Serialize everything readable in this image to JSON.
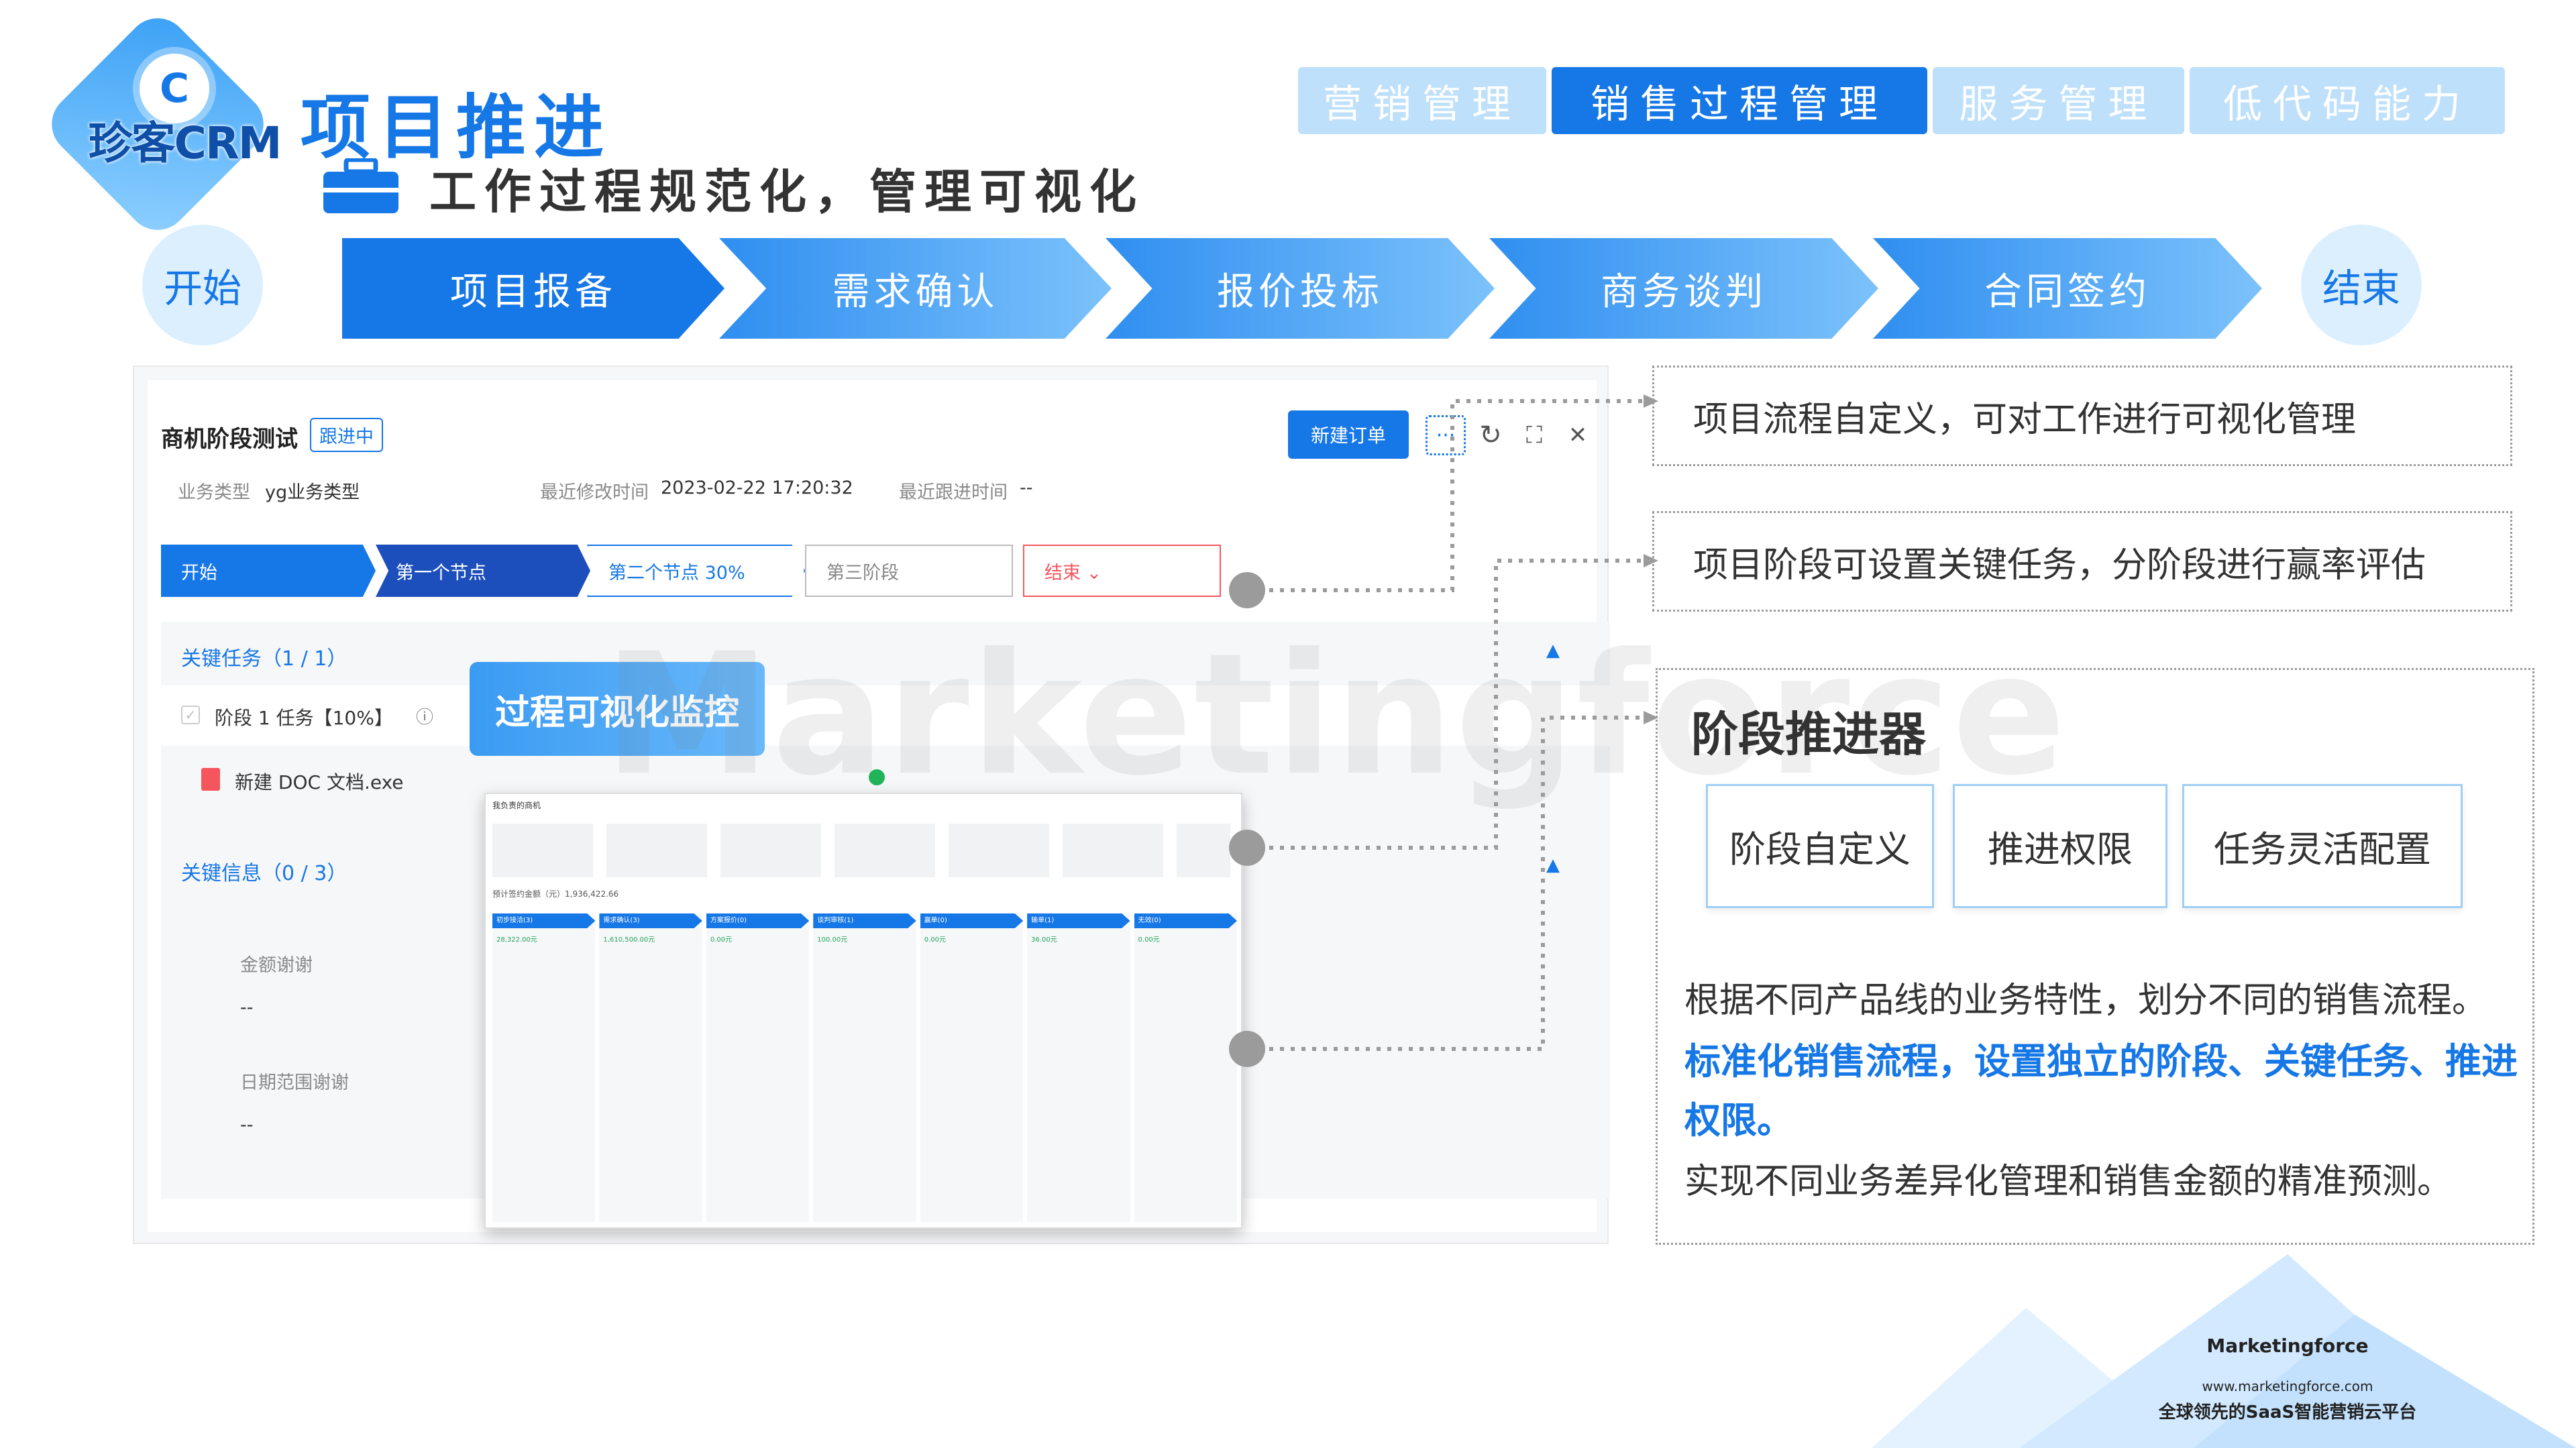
{
  "brand": {
    "logo_letter": "C",
    "logo_text": "珍客CRM"
  },
  "header": {
    "title": "项目推进",
    "subtitle": "工作过程规范化，管理可视化"
  },
  "nav": {
    "tabs": [
      {
        "label": "营销管理",
        "active": false
      },
      {
        "label": "销售过程管理",
        "active": true
      },
      {
        "label": "服务管理",
        "active": false
      },
      {
        "label": "低代码能力",
        "active": false
      }
    ]
  },
  "process": {
    "start": "开始",
    "end": "结束",
    "steps": [
      "项目报备",
      "需求确认",
      "报价投标",
      "商务谈判",
      "合同签约"
    ]
  },
  "app": {
    "title": "商机阶段测试",
    "badge": "跟进中",
    "business_type_label": "业务类型",
    "business_type_value": "yg业务类型",
    "modified_label": "最近修改时间",
    "modified_value": "2023-02-22 17:20:32",
    "followup_label": "最近跟进时间",
    "followup_value": "--",
    "new_order_label": "新建订单",
    "more_label": "···",
    "refresh_icon": "↻",
    "expand_icon": "⛶",
    "close_icon": "✕",
    "stages": [
      "开始",
      "第一个节点",
      "第二个节点 30%",
      "第三阶段",
      "结束 ⌄"
    ],
    "key_tasks_title": "关键任务（1 / 1）",
    "task_item": "阶段 1 任务【10%】",
    "task_file": "新建 DOC 文档.exe",
    "key_info_title": "关键信息（0 / 3）",
    "field1_label": "金额谢谢",
    "field1_value": "--",
    "field2_label": "日期范围谢谢",
    "field2_value": "--",
    "collapse_label": "收起",
    "monitor_label": "过程可视化监控",
    "mini_title": "我负责的商机",
    "mini_stats": "预计签约金额（元）1,936,422.66",
    "mini_columns": [
      "初步接洽(3)",
      "需求确认(3)",
      "方案报价(0)",
      "谈判审核(1)",
      "赢单(0)",
      "输单(1)",
      "无效(0)"
    ],
    "mini_amounts": [
      "28,322.00元",
      "1,610,500.00元",
      "0.00元",
      "100.00元",
      "0.00元",
      "36.00元",
      "0.00元"
    ]
  },
  "watermark": "Marketingforce",
  "features": {
    "f1": "项目流程自定义，可对工作进行可视化管理",
    "f2": "项目阶段可设置关键任务，分阶段进行赢率评估",
    "advancer_title": "阶段推进器",
    "cards": [
      "阶段自定义",
      "推进权限",
      "任务灵活配置"
    ],
    "p1": "根据不同产品线的业务特性，划分不同的销售流程。",
    "p2": "标准化销售流程，设置独立的阶段、关键任务、推进权限。",
    "p3": "实现不同业务差异化管理和销售金额的精准预测。"
  },
  "footer": {
    "logo_text": "Marketingforce",
    "url": "www.marketingforce.com",
    "slogan": "全球领先的SaaS智能营销云平台"
  },
  "colors": {
    "primary": "#1677e6",
    "light_tab": "#bfe0fb",
    "circle": "#dcefff",
    "danger": "#f5565d"
  }
}
